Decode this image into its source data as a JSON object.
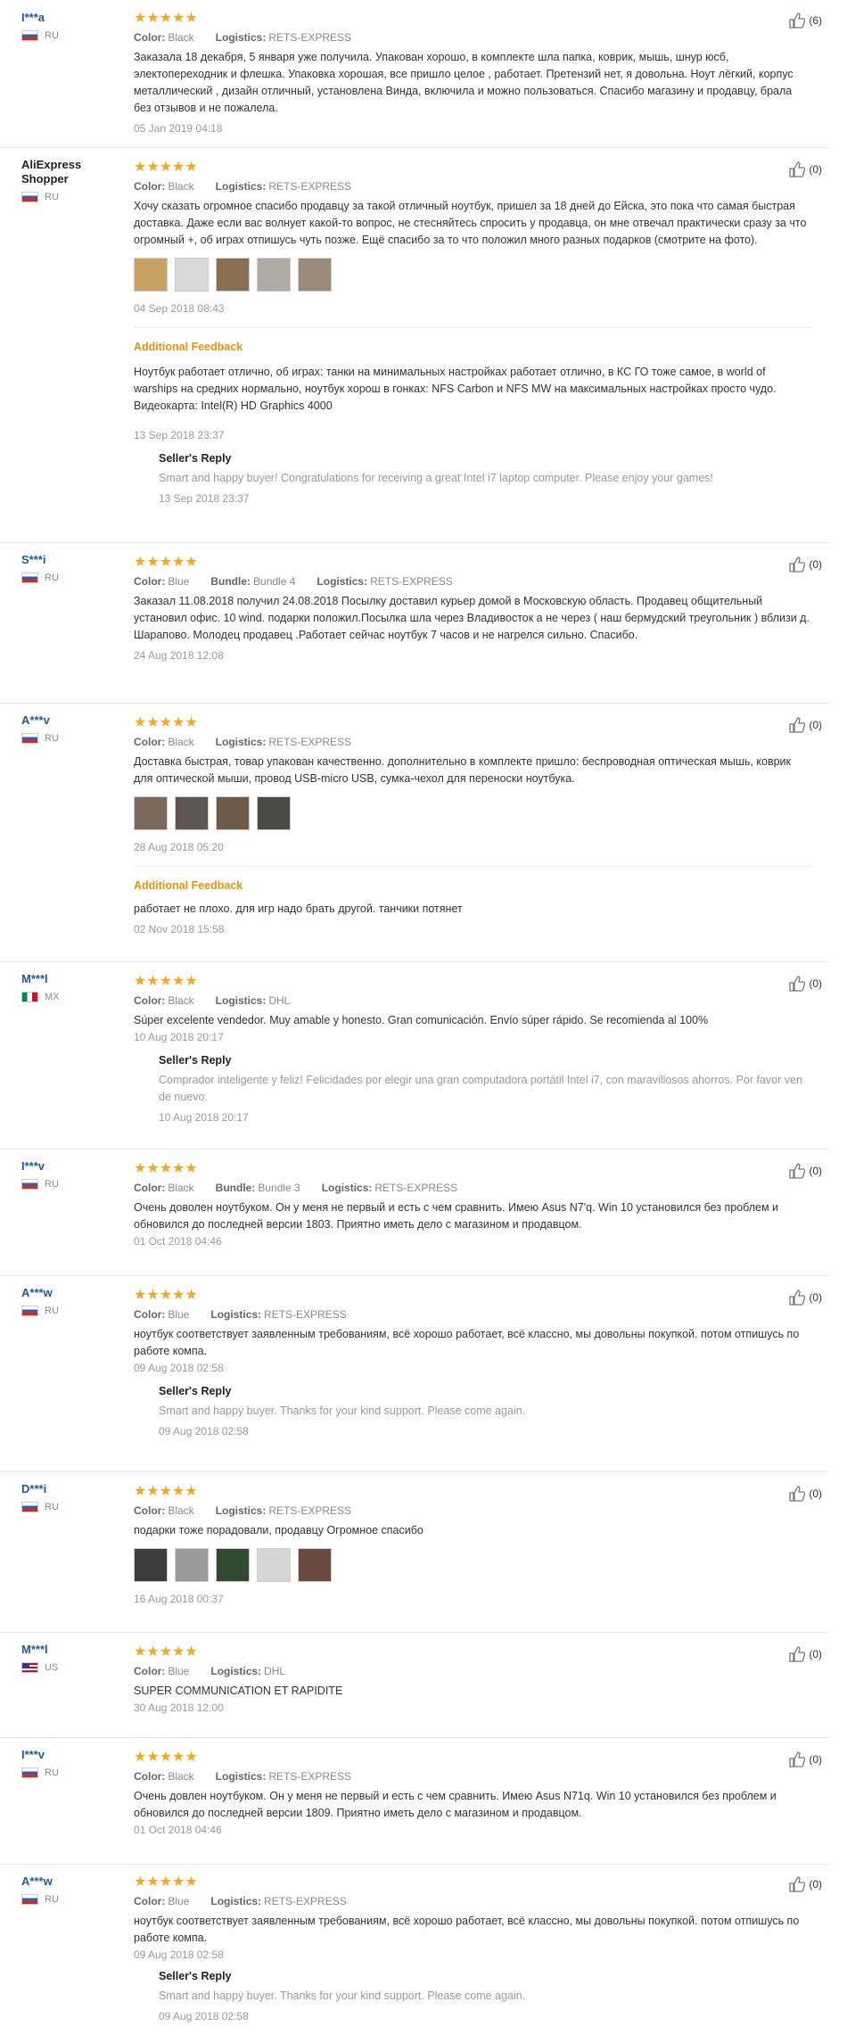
{
  "labels": {
    "color": "Color:",
    "logistics": "Logistics:",
    "bundle": "Bundle:",
    "additional_feedback": "Additional Feedback",
    "sellers_reply": "Seller's Reply",
    "stars": "★★★★★"
  },
  "colors": {
    "star": "#f5a623",
    "user_link": "#1e5a9c",
    "additional": "#e2930e"
  },
  "reviews": [
    {
      "user": "I***a",
      "country": "RU",
      "color": "Black",
      "logistics": "RETS-EXPRESS",
      "helpful": "(6)",
      "text": "Заказала 18 декабря, 5 января уже получила. Упакован хорошо, в комплекте шла папка, коврик, мышь, шнур юсб, электопереходник и флешка. Упаковка хорошая, все пришло целое , работает. Претензий нет, я довольна. Ноут лёгкий, корпус металлический , дизайн отличный, установлена Винда, включила и можно пользоваться. Спасибо магазину и продавцу, брала без отзывов и не пожалела.",
      "date": "05 Jan 2019 04:18"
    },
    {
      "user": "AliExpress Shopper",
      "country": "RU",
      "color": "Black",
      "logistics": "RETS-EXPRESS",
      "helpful": "(0)",
      "text": "Хочу сказать огромное спасибо продавцу за такой отличный ноутбук, пришел за 18 дней до Ейска, это пока что самая быстрая доставка. Даже если вас волнует какой-то вопрос, не стесняйтесь спросить у продавца, он мне отвечал практически сразу за что огромный +, об играх отпишусь чуть позже. Ещё спасибо за то что положил много разных подарков (смотрите на фото).",
      "date": "04 Sep 2018 08:43",
      "additional_text": "Ноутбук работает отлично, об играх: танки на минимальных настройках работает отлично, в КС ГО тоже самое, в world of warships на средних нормально, ноутбук хорош в гонках: NFS Carbon и NFS MW на максимальных настройках просто чудо. Видеокарта: Intel(R) HD Graphics 4000",
      "additional_date": "13 Sep 2018 23:37",
      "reply_text": "Smart and happy buyer! Congratulations for receiving a great Intel i7 laptop computer. Please enjoy your games!",
      "reply_date": "13 Sep 2018 23:37"
    },
    {
      "user": "S***i",
      "country": "RU",
      "color": "Blue",
      "bundle": "Bundle 4",
      "logistics": "RETS-EXPRESS",
      "helpful": "(0)",
      "text": "Заказал 11.08.2018 получил 24.08.2018  Посылку доставил курьер домой в Московскую область. Продавец общительный установил офис. 10 wind. подарки положил.Посылка шла через Владивосток а не через ( наш бермудский треугольник ) вблизи д. Шарапово. Молодец продавец .Работает сейчас ноутбук 7 часов и не нагрелся сильно. Спасибо.",
      "date": "24 Aug 2018 12:08"
    },
    {
      "user": "A***v",
      "country": "RU",
      "color": "Black",
      "logistics": "RETS-EXPRESS",
      "helpful": "(0)",
      "text": "Доставка быстрая, товар упакован качественно. дополнительно в комплекте пришло: беспроводная оптическая мышь, коврик для оптической мыши, провод USB-micro USB, сумка-чехол для переноски ноутбука.",
      "date": "28 Aug 2018 05:20",
      "additional_text": "работает не плохо. для игр надо брать другой. танчики потянет",
      "additional_date": "02 Nov 2018 15:58"
    },
    {
      "user": "M***l",
      "country": "MX",
      "color": "Black",
      "logistics": "DHL",
      "helpful": "(0)",
      "text": "Súper excelente vendedor. Muy amable y honesto. Gran comunicación. Envío súper rápido. Se recomienda al 100%",
      "date": "10 Aug 2018 20:17",
      "reply_text": "Comprador inteligente y feliz! Felicidades por elegir una gran computadora portátil Intel i7, con maravillosos ahorros. Por favor ven de nuevo.",
      "reply_date": "10 Aug 2018 20:17"
    },
    {
      "user": "I***v",
      "country": "RU",
      "color": "Black",
      "bundle": "Bundle 3",
      "logistics": "RETS-EXPRESS",
      "helpful": "(0)",
      "text": "Очень доволен ноутбуком. Он у меня не первый и есть с чем сравнить. Имею Asus N7'q. Win 10 установился без проблем и обновился до последней версии 1803. Приятно иметь дело с магазином и продавцом.",
      "date": "01 Oct 2018 04:46"
    },
    {
      "user": "A***w",
      "country": "RU",
      "color": "Blue",
      "logistics": "RETS-EXPRESS",
      "helpful": "(0)",
      "text": "ноутбук соответствует заявленным требованиям, всё хорошо работает, всё классно, мы довольны покупкой. потом отпишусь по работе компа.",
      "date": "09 Aug 2018 02:58",
      "reply_text": "Smart and happy buyer. Thanks for your kind support. Please come again.",
      "reply_date": "09 Aug 2018 02:58"
    },
    {
      "user": "D***i",
      "country": "RU",
      "color": "Black",
      "logistics": "RETS-EXPRESS",
      "helpful": "(0)",
      "text": "подарки тоже порадовали, продавцу Огромное спасибо",
      "date": "16 Aug 2018 00:37"
    },
    {
      "user": "M***l",
      "country": "US",
      "color": "Blue",
      "logistics": "DHL",
      "helpful": "(0)",
      "text": "SUPER COMMUNICATION ET RAPIDITE",
      "date": "30 Aug 2018 12:00"
    },
    {
      "user": "I***v",
      "country": "RU",
      "color": "Black",
      "logistics": "RETS-EXPRESS",
      "helpful": "(0)",
      "text": "Очень довлен ноутбуком. Он у меня не первый и есть с чем сравнить. Имею Asus N71q. Win 10 установился без проблем и обновился до последней версии 1809. Приятно иметь дело с магазином и продавцом.",
      "date": "01 Oct 2018 04:46"
    },
    {
      "user": "A***w",
      "country": "RU",
      "color": "Blue",
      "logistics": "RETS-EXPRESS",
      "helpful": "(0)",
      "text": "ноутбук соответствует заявленным требованиям, всё хорошо работает, всё классно, мы довольны покупкой. потом отпишусь по работе компа.",
      "date": "09 Aug 2018 02:58",
      "reply_text": "Smart and happy buyer. Thanks for your kind support. Please come again.",
      "reply_date": "09 Aug 2018 02:58"
    }
  ]
}
